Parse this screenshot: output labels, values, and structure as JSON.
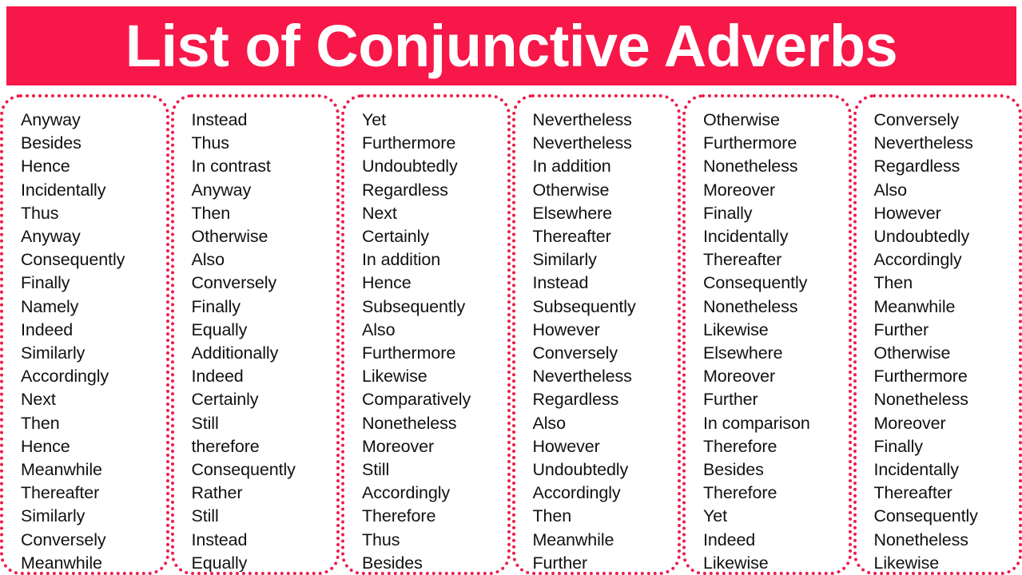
{
  "header": {
    "title": "List of Conjunctive Adverbs",
    "background_color": "#F71749",
    "text_color": "#FFFFFF"
  },
  "style": {
    "card_border_color": "#EE1C4A",
    "word_color": "#111111",
    "page_background": "#FFFFFF"
  },
  "columns": [
    {
      "index": 1,
      "words": [
        "Anyway",
        "Besides",
        "Hence",
        "Incidentally",
        "Thus",
        "Anyway",
        "Consequently",
        "Finally",
        "Namely",
        "Indeed",
        "Similarly",
        "Accordingly",
        "Next",
        "Then",
        "Hence",
        "Meanwhile",
        "Thereafter",
        "Similarly",
        "Conversely",
        "Meanwhile"
      ]
    },
    {
      "index": 2,
      "words": [
        "Instead",
        "Thus",
        "In contrast",
        "Anyway",
        "Then",
        "Otherwise",
        "Also",
        "Conversely",
        "Finally",
        "Equally",
        "Additionally",
        "Indeed",
        "Certainly",
        "Still",
        "therefore",
        "Consequently",
        "Rather",
        "Still",
        "Instead",
        "Equally"
      ]
    },
    {
      "index": 3,
      "words": [
        "Yet",
        "Furthermore",
        "Undoubtedly",
        "Regardless",
        "Next",
        "Certainly",
        "In addition",
        "Hence",
        "Subsequently",
        "Also",
        "Furthermore",
        "Likewise",
        "Comparatively",
        "Nonetheless",
        "Moreover",
        "Still",
        "Accordingly",
        "Therefore",
        "Thus",
        "Besides"
      ]
    },
    {
      "index": 4,
      "words": [
        "Nevertheless",
        "Nevertheless",
        "In addition",
        "Otherwise",
        "Elsewhere",
        "Thereafter",
        "Similarly",
        "Instead",
        "Subsequently",
        "However",
        "Conversely",
        "Nevertheless",
        "Regardless",
        "Also",
        "However",
        "Undoubtedly",
        "Accordingly",
        "Then",
        "Meanwhile",
        "Further"
      ]
    },
    {
      "index": 5,
      "words": [
        "Otherwise",
        "Furthermore",
        "Nonetheless",
        "Moreover",
        "Finally",
        "Incidentally",
        "Thereafter",
        "Consequently",
        "Nonetheless",
        "Likewise",
        "Elsewhere",
        "Moreover",
        "Further",
        "In comparison",
        "Therefore",
        "Besides",
        "Therefore",
        "Yet",
        "Indeed",
        "Likewise"
      ]
    },
    {
      "index": 6,
      "words": [
        "Conversely",
        "Nevertheless",
        "Regardless",
        "Also",
        "However",
        "Undoubtedly",
        "Accordingly",
        "Then",
        "Meanwhile",
        "Further",
        "Otherwise",
        "Furthermore",
        "Nonetheless",
        "Moreover",
        "Finally",
        "Incidentally",
        "Thereafter",
        "Consequently",
        "Nonetheless",
        "Likewise"
      ]
    }
  ]
}
